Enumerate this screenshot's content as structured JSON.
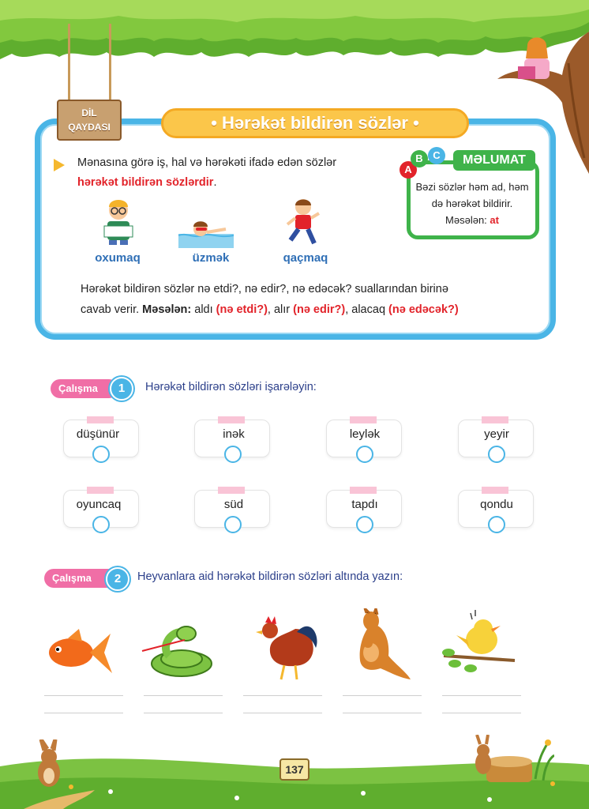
{
  "sign": {
    "line1": "DİL",
    "line2": "QAYDASI"
  },
  "title": "• Hərəkət bildirən sözlər •",
  "rule": {
    "text1": "Mənasına görə iş, hal və hərəkəti ifadə edən sözlər",
    "text2_bold": "hərəkət bildirən sözlərdir",
    "text2_end": "."
  },
  "examples": [
    "oxumaq",
    "üzmək",
    "qaçmaq"
  ],
  "question_text": {
    "line1": "Hərəkət bildirən sözlər nə etdi?, nə edir?, nə edəcək? suallarından birinə",
    "line2_a": "cavab verir. ",
    "line2_bold": "Məsələn:",
    "line2_b": " aldı ",
    "q1": "(nə etdi?)",
    "line2_c": ", alır ",
    "q2": "(nə edir?)",
    "line2_d": ", alacaq ",
    "q3": "(nə edəcək?)"
  },
  "info": {
    "label": "MƏLUMAT",
    "abc": [
      "A",
      "B",
      "C"
    ],
    "text": "Bəzi sözlər həm ad, həm də hərəkət bildirir. Məsələn: ",
    "example": "at"
  },
  "exercise1": {
    "label": "Çalışma",
    "number": "1",
    "instruction": "Hərəkət bildirən sözləri işarələyin:",
    "words": [
      "düşünür",
      "inək",
      "leylək",
      "yeyir",
      "oyuncaq",
      "süd",
      "tapdı",
      "qondu"
    ]
  },
  "exercise2": {
    "label": "Çalışma",
    "number": "2",
    "instruction": "Heyvanlara aid hərəkət bildirən sözləri altında yazın:",
    "animals": [
      "goldfish",
      "snake",
      "rooster",
      "kangaroo",
      "bird"
    ]
  },
  "page_number": "137",
  "colors": {
    "accent_blue": "#4ab5e6",
    "title_yellow": "#fbc64a",
    "info_green": "#3fb34a",
    "red": "#e2232a",
    "pink": "#f06ea6"
  }
}
